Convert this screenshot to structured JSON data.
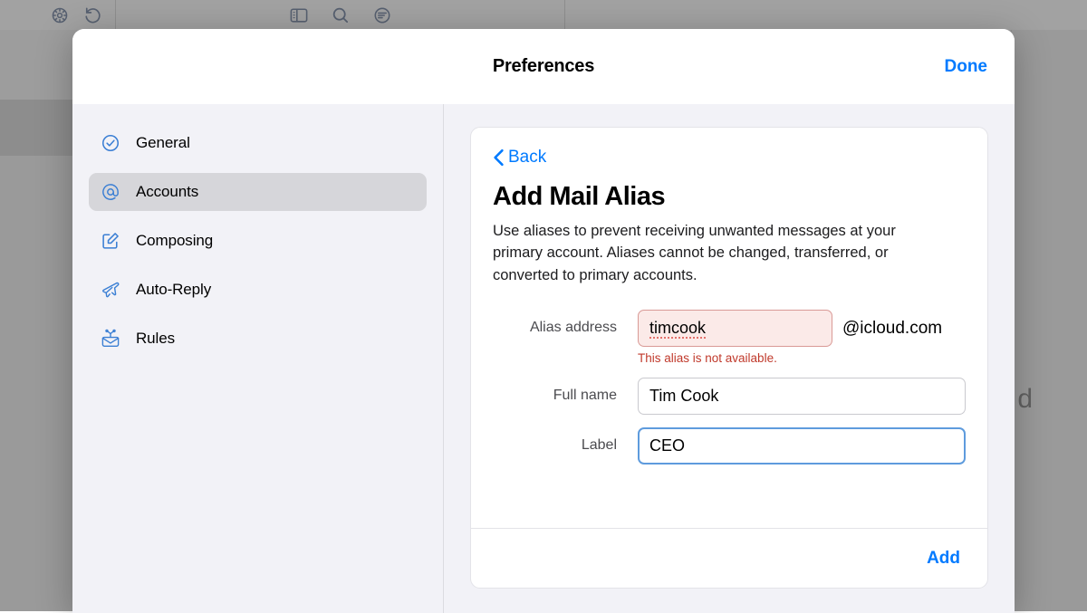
{
  "background": {
    "toolbar": {
      "left_icons": [
        {
          "name": "gear-icon",
          "label": "Settings"
        },
        {
          "name": "undo-icon",
          "label": "Undo"
        }
      ],
      "center_icons": [
        {
          "name": "sidebar-toggle-icon",
          "label": "Toggle Sidebar"
        },
        {
          "name": "search-icon",
          "label": "Search"
        },
        {
          "name": "filter-icon",
          "label": "Filter"
        }
      ]
    },
    "right_partial_glyph": "d"
  },
  "dialog": {
    "title": "Preferences",
    "done_label": "Done"
  },
  "sidebar": {
    "items": [
      {
        "label": "General",
        "icon": "check-circle-icon",
        "selected": false
      },
      {
        "label": "Accounts",
        "icon": "at-sign-icon",
        "selected": true
      },
      {
        "label": "Composing",
        "icon": "compose-icon",
        "selected": false
      },
      {
        "label": "Auto-Reply",
        "icon": "paper-plane-icon",
        "selected": false
      },
      {
        "label": "Rules",
        "icon": "mail-rules-icon",
        "selected": false
      }
    ]
  },
  "content": {
    "back_label": "Back",
    "heading": "Add Mail Alias",
    "description": "Use aliases to prevent receiving unwanted messages at your primary account. Aliases cannot be changed, transferred, or converted to primary accounts.",
    "fields": {
      "alias": {
        "label": "Alias address",
        "value": "timcook",
        "placeholder": "",
        "domain_suffix": "@icloud.com",
        "error": "This alias is not available."
      },
      "full_name": {
        "label": "Full name",
        "value": "Tim Cook",
        "placeholder": ""
      },
      "alias_label": {
        "label": "Label",
        "value": "CEO",
        "placeholder": ""
      }
    },
    "add_label": "Add"
  },
  "colors": {
    "accent_blue": "#007aff",
    "error_red": "#c0392b",
    "error_field_bg": "#fbeae8",
    "error_field_border": "#d99a96",
    "focus_border": "#5e9bdd",
    "sidebar_bg": "#f2f2f7",
    "selected_row": "#d6d6da"
  }
}
